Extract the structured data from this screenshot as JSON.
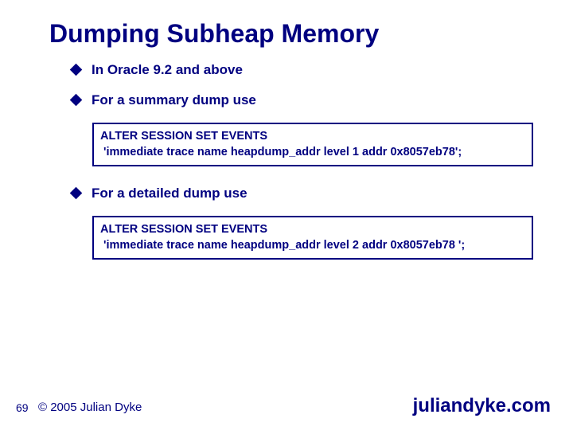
{
  "slide": {
    "title": "Dumping Subheap Memory",
    "bullets": [
      {
        "text": "In Oracle 9.2 and above"
      },
      {
        "text": "For a summary dump use"
      },
      {
        "text": "For a detailed dump use"
      }
    ],
    "code1_line1": "ALTER SESSION SET EVENTS",
    "code1_line2": " 'immediate trace name heapdump_addr level 1 addr 0x8057eb78';",
    "code2_line1": "ALTER SESSION SET EVENTS",
    "code2_line2": " 'immediate trace name heapdump_addr level 2 addr 0x8057eb78 ';"
  },
  "footer": {
    "page": "69",
    "copyright": "© 2005 Julian Dyke",
    "brand": "juliandyke.com"
  }
}
